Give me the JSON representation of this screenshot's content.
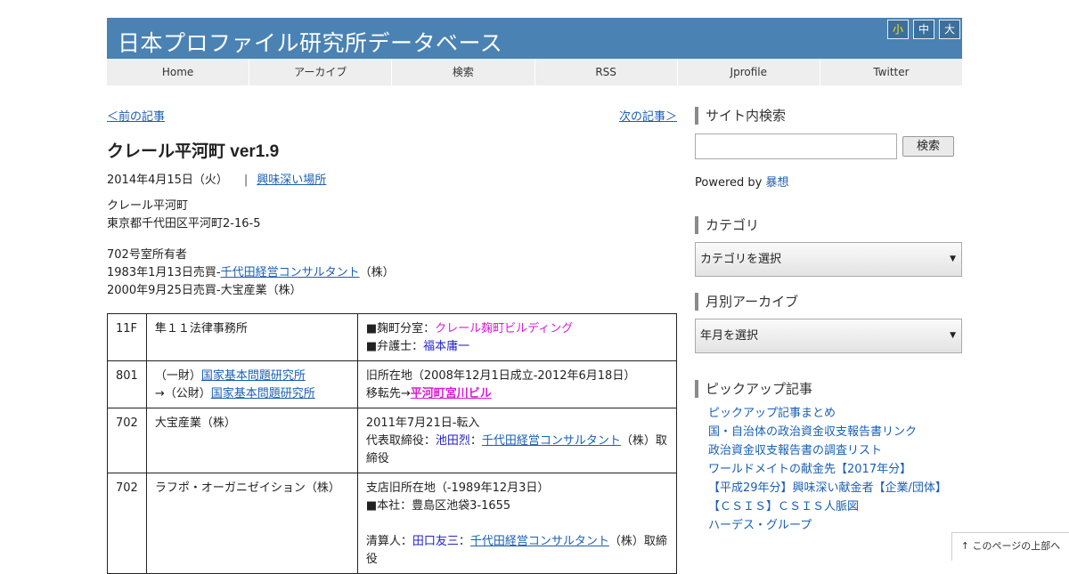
{
  "site": {
    "title": "日本プロファイル研究所データベース",
    "font_sizes": [
      "小",
      "中",
      "大"
    ]
  },
  "nav": [
    "Home",
    "アーカイブ",
    "検索",
    "RSS",
    "Jprofile",
    "Twitter"
  ],
  "post": {
    "prev_link": "＜前の記事",
    "next_link": "次の記事＞",
    "title": "クレール平河町 ver1.9",
    "date": "2014年4月15日（火）",
    "separator": "|",
    "category": "興味深い場所",
    "name": "クレール平河町",
    "address": "東京都千代田区平河町2-16-5",
    "owner_heading": "702号室所有者",
    "owner_line1_prefix": "1983年1月13日売買-",
    "owner_line1_link": "千代田経営コンサルタント",
    "owner_line1_suffix": "（株）",
    "owner_line2": "2000年9月25日売買-大宝産業（株）"
  },
  "table": {
    "r1": {
      "floor": "11F",
      "name": "隼１１法律事務所",
      "d1_prefix": "■麹町分室：",
      "d1_link": "クレール麹町ビルディング",
      "d2_prefix": "■弁護士：",
      "d2_link": "福本庸一"
    },
    "r2": {
      "floor": "801",
      "name1_prefix": "（一財）",
      "name1_link": "国家基本問題研究所",
      "name2_prefix": "→（公財）",
      "name2_link": "国家基本問題研究所",
      "d1": "旧所在地（2008年12月1日成立-2012年6月18日）",
      "d2_prefix": "移転先→",
      "d2_link": "平河町宮川ビル"
    },
    "r3": {
      "floor": "702",
      "name": "大宝産業（株）",
      "d1": "2011年7月21日-転入",
      "d2_prefix": "代表取締役：",
      "d2_person": "池田烈",
      "d2_colon": "：",
      "d2_link": "千代田経営コンサルタント",
      "d2_suffix": "（株）取締役"
    },
    "r4": {
      "floor": "702",
      "name": "ラフポ・オーガニゼイション（株）",
      "d1": "支店旧所在地（-1989年12月3日）",
      "d2": "■本社：豊島区池袋3-1655",
      "d3_prefix": "清算人：",
      "d3_person": "田口友三",
      "d3_colon": "：",
      "d3_link": "千代田経営コンサルタント",
      "d3_suffix": "（株）取締役"
    }
  },
  "sidebar": {
    "search_title": "サイト内検索",
    "search_button": "検索",
    "powered_prefix": "Powered by",
    "powered_link": "暴想",
    "category_title": "カテゴリ",
    "category_select": "カテゴリを選択",
    "archive_title": "月別アーカイブ",
    "archive_select": "年月を選択",
    "pickup_title": "ピックアップ記事",
    "pickup_items": [
      "ピックアップ記事まとめ",
      "国・自治体の政治資金収支報告書リンク",
      "政治資金収支報告書の調査リスト",
      "ワールドメイトの献金先【2017年分】",
      "【平成29年分】興味深い献金者【企業/団体】",
      "【ＣＳＩＳ】ＣＳＩＳ人脈図",
      "ハーデス・グループ"
    ]
  },
  "to_top": "↑ このページの上部へ",
  "colors": {
    "header_bg": "#4a82b4",
    "nav_bg": "#eeeeee",
    "link": "#1a5fb4",
    "pink_link": "#d81bd6",
    "person_link": "#2222cc"
  }
}
